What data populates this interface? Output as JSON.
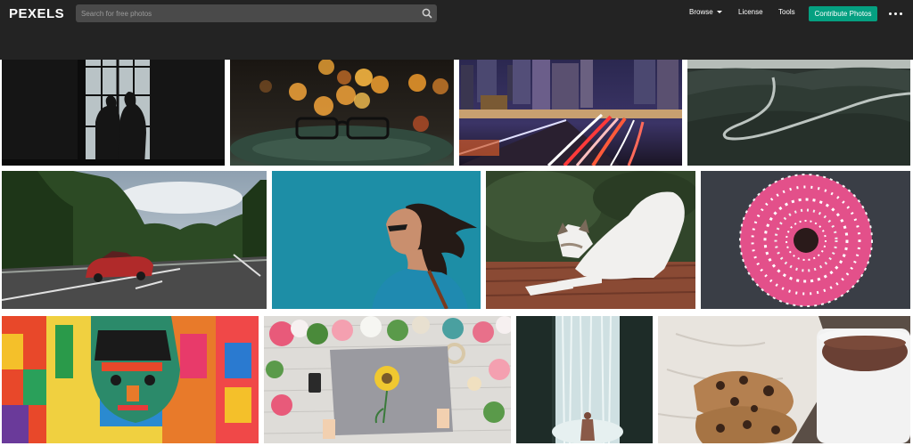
{
  "header": {
    "logo": "PEXELS",
    "search": {
      "placeholder": "Search for free photos",
      "value": ""
    },
    "nav": {
      "browse": "Browse",
      "license": "License",
      "tools": "Tools",
      "contribute": "Contribute Photos"
    },
    "more_icon": "ellipsis-icon",
    "colors": {
      "bar": "#232323",
      "search": "#4a4a4a",
      "accent": "#05a081"
    }
  },
  "gallery": {
    "rows": [
      [
        "couple-silhouette-window",
        "eyeglasses-bokeh",
        "city-night-traffic",
        "winding-mountain-road"
      ],
      [
        "red-convertible-highway",
        "woman-teal-background",
        "cat-stretching",
        "pink-sprinkled-donut"
      ],
      [
        "colorful-mural-face",
        "flowers-sunflower-drawing",
        "waterfall-person",
        "cookies-hot-chocolate"
      ]
    ]
  }
}
